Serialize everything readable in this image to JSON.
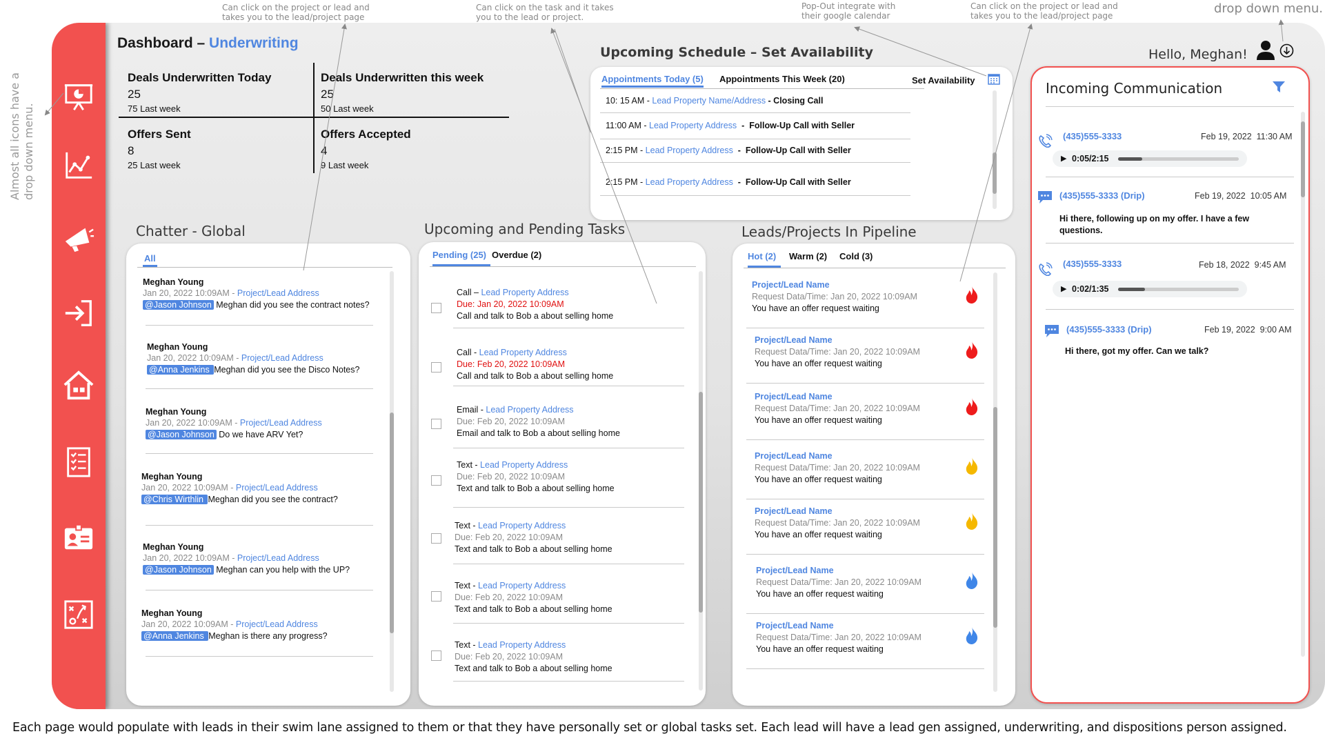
{
  "annotations": {
    "top1": "Can click on the project or lead and\ntakes you to the lead/project page",
    "top2": "Can click on the task and it takes\nyou to the lead or project.",
    "top3": "Pop-Out integrate with\ntheir google calendar",
    "top4": "Can click on the project or lead and\ntakes you to the lead/project page",
    "top5": "drop down menu.",
    "side": "Almost all icons have a\ndrop down menu.",
    "footer": "Each page would populate with leads in their swim lane assigned to them or that they have personally set or global tasks set. Each lead will have a lead gen assigned, underwriting, and dispositions person assigned."
  },
  "header": {
    "title_prefix": "Dashboard – ",
    "title_highlight": "Underwriting",
    "greeting": "Hello, Meghan!"
  },
  "sidebar": {
    "icons": [
      "presentation-icon",
      "analytics-chart-icon",
      "megaphone-icon",
      "sign-in-icon",
      "home-icon",
      "checklist-icon",
      "contact-card-icon",
      "strategy-board-icon"
    ]
  },
  "stats": [
    {
      "label": "Deals Underwritten Today",
      "value": "25",
      "sub": "75 Last week"
    },
    {
      "label": "Deals Underwritten this week",
      "value": "25",
      "sub": "50 Last week"
    },
    {
      "label": "Offers Sent",
      "value": "8",
      "sub": "25 Last week"
    },
    {
      "label": "Offers Accepted",
      "value": "4",
      "sub": "9 Last week"
    }
  ],
  "schedule": {
    "title": "Upcoming Schedule – Set Availability",
    "tab_today": "Appointments Today (5)",
    "tab_week": "Appointments This Week (20)",
    "set_availability": "Set Availability",
    "items": [
      {
        "time": "10: 15 AM - ",
        "link": "Lead Property Name/Address",
        "desc": " - Closing Call"
      },
      {
        "time": "11:00 AM - ",
        "link": "Lead Property Address",
        "desc": "  -  Follow-Up Call with Seller"
      },
      {
        "time": "2:15 PM - ",
        "link": "Lead Property Address",
        "desc": "  -  Follow-Up Call with Seller"
      },
      {
        "time": "2:15 PM - ",
        "link": "Lead Property Address",
        "desc": "  -  Follow-Up Call with Seller"
      }
    ]
  },
  "chatter": {
    "title": "Chatter - Global",
    "tab": "All",
    "items": [
      {
        "author": "Meghan Young",
        "time": "Jan 20, 2022  10:09AM - ",
        "link": "Project/Lead Address",
        "mention": "@Jason Johnson",
        "msg": " Meghan did you see the contract notes?"
      },
      {
        "author": "Meghan Young",
        "time": "Jan 20, 2022  10:09AM - ",
        "link": "Project/Lead Address",
        "mention": "@Anna Jenkins ",
        "msg": "Meghan did you see the Disco Notes?"
      },
      {
        "author": "Meghan Young",
        "time": "Jan 20, 2022  10:09AM - ",
        "link": "Project/Lead Address",
        "mention": "@Jason Johnson",
        "msg": " Do we have ARV Yet?"
      },
      {
        "author": "Meghan Young",
        "time": "Jan 20, 2022  10:09AM - ",
        "link": "Project/Lead Address",
        "mention": "@Chris Wirthlin ",
        "msg": " Meghan did you see the contract?"
      },
      {
        "author": "Meghan Young",
        "time": "Jan 20, 2022  10:09AM - ",
        "link": "Project/Lead Address",
        "mention": "@Jason Johnson",
        "msg": " Meghan can you help with the UP?"
      },
      {
        "author": "Meghan Young",
        "time": "Jan 20, 2022  10:09AM - ",
        "link": "Project/Lead Address",
        "mention": "@Anna Jenkins ",
        "msg": "Meghan is there any progress?"
      }
    ]
  },
  "tasks": {
    "title": "Upcoming and Pending Tasks",
    "tab_pending": "Pending (25)",
    "tab_overdue": "Overdue (2)",
    "items": [
      {
        "type": "Call – ",
        "link": "Lead Property Address",
        "due": "Due: Jan 20, 2022  10:09AM",
        "overdue": true,
        "desc": "Call and talk to Bob a about selling home"
      },
      {
        "type": "Call - ",
        "link": "Lead Property Address",
        "due": "Due: Feb 20, 2022  10:09AM",
        "overdue": true,
        "desc": "Call and talk to Bob a about selling home"
      },
      {
        "type": "Email - ",
        "link": "Lead Property Address",
        "due": "Due: Feb 20, 2022  10:09AM",
        "overdue": false,
        "desc": "Email and talk to Bob a about selling home"
      },
      {
        "type": "Text - ",
        "link": "Lead Property Address",
        "due": "Due: Feb 20, 2022  10:09AM",
        "overdue": false,
        "desc": "Text and talk to Bob a about selling home"
      },
      {
        "type": "Text - ",
        "link": "Lead Property Address",
        "due": "Due: Feb 20, 2022  10:09AM",
        "overdue": false,
        "desc": "Text and talk to Bob a about selling home"
      },
      {
        "type": "Text - ",
        "link": "Lead Property Address",
        "due": "Due: Feb 20, 2022  10:09AM",
        "overdue": false,
        "desc": "Text and talk to Bob a about selling home"
      },
      {
        "type": "Text - ",
        "link": "Lead Property Address",
        "due": "Due: Feb 20, 2022  10:09AM",
        "overdue": false,
        "desc": "Text and talk to Bob a about selling home"
      }
    ]
  },
  "pipeline": {
    "title": "Leads/Projects In Pipeline",
    "tab_hot": "Hot (2)",
    "tab_warm": "Warm (2)",
    "tab_cold": "Cold (3)",
    "items": [
      {
        "name": "Project/Lead Name",
        "req": "Request Data/Time: Jan 20, 2022  10:09AM",
        "msg": "You have an offer request waiting",
        "heat": "hot",
        "color": "#ee1c1c"
      },
      {
        "name": "Project/Lead Name",
        "req": "Request Data/Time: Jan 20, 2022  10:09AM",
        "msg": "You have an offer request waiting",
        "heat": "hot",
        "color": "#ee1c1c"
      },
      {
        "name": "Project/Lead Name",
        "req": "Request Data/Time: Jan 20, 2022  10:09AM",
        "msg": "You have an offer request waiting",
        "heat": "hot",
        "color": "#ee1c1c"
      },
      {
        "name": "Project/Lead Name",
        "req": "Request Data/Time: Jan 20, 2022  10:09AM",
        "msg": "You have an offer request waiting",
        "heat": "warm",
        "color": "#f5b800"
      },
      {
        "name": "Project/Lead Name",
        "req": "Request Data/Time: Jan 20, 2022  10:09AM",
        "msg": "You have an offer request waiting",
        "heat": "warm",
        "color": "#f5b800"
      },
      {
        "name": "Project/Lead Name",
        "req": "Request Data/Time: Jan 20, 2022  10:09AM",
        "msg": "You have an offer request waiting",
        "heat": "cold",
        "color": "#3f86e8"
      },
      {
        "name": "Project/Lead Name",
        "req": "Request Data/Time: Jan 20, 2022  10:09AM",
        "msg": "You have an offer request waiting",
        "heat": "cold",
        "color": "#3f86e8"
      }
    ]
  },
  "communication": {
    "title": "Incoming Communication",
    "items": [
      {
        "kind": "call",
        "number": "(435)555-3333",
        "time": "Feb 19, 2022  11:30 AM",
        "audio": "0:05/2:15",
        "progress": 0.2
      },
      {
        "kind": "message",
        "number": "(435)555-3333 (Drip)",
        "time": "Feb 19, 2022  10:05 AM",
        "text": "Hi there, following up on my offer. I have a few questions."
      },
      {
        "kind": "call",
        "number": "(435)555-3333",
        "time": "Feb 18, 2022  9:45 AM",
        "audio": "0:02/1:35",
        "progress": 0.22
      },
      {
        "kind": "message",
        "number": "(435)555-3333 (Drip)",
        "time": "Feb 19, 2022  9:00 AM",
        "text": "Hi there, got my offer. Can we talk?"
      }
    ]
  },
  "colors": {
    "brand_red": "#f2514f",
    "link_blue": "#4f86e0",
    "overdue_red": "#e01010"
  }
}
